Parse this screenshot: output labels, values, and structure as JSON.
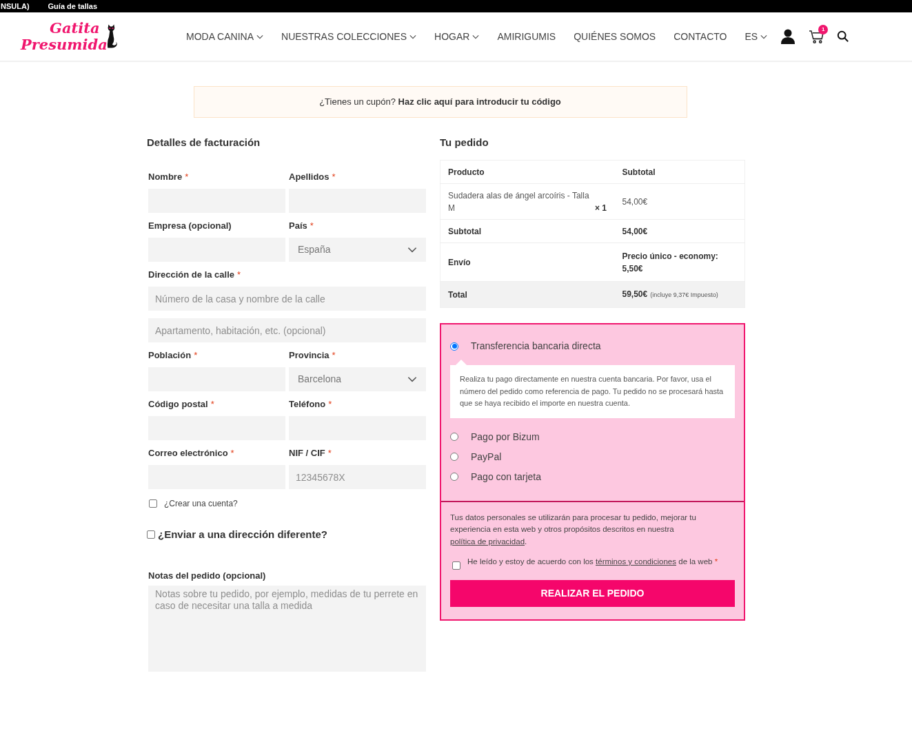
{
  "top_bar": {
    "items": [
      "NSULA)",
      "Guía de tallas"
    ]
  },
  "header": {
    "logo": {
      "line_1": "Gatita",
      "line_2": "Presumida"
    },
    "nav": [
      {
        "label": "MODA CANINA",
        "dropdown": true
      },
      {
        "label": "NUESTRAS COLECCIONES",
        "dropdown": true
      },
      {
        "label": "HOGAR",
        "dropdown": true
      },
      {
        "label": "AMIRIGUMIS",
        "dropdown": false
      },
      {
        "label": "QUIÉNES SOMOS",
        "dropdown": false
      },
      {
        "label": "CONTACTO",
        "dropdown": false
      },
      {
        "label": "ES",
        "dropdown": true
      }
    ],
    "cart_count": "1"
  },
  "coupon": {
    "text": "¿Tienes un cupón? **Haz clic aquí para introducir tu código**"
  },
  "billing": {
    "title": "Detalles de facturación",
    "rows": [
      [
        {
          "label": "Nombre",
          "required_mark": "*",
          "inputs": [
            {
              "kind": "input"
            }
          ]
        },
        {
          "label": "Apellidos",
          "required_mark": "*",
          "inputs": [
            {
              "kind": "input"
            }
          ]
        }
      ],
      [
        {
          "label": "Empresa (opcional)",
          "inputs": [
            {
              "kind": "input"
            }
          ]
        },
        {
          "label": "País",
          "required_mark": "*",
          "inputs": [
            {
              "kind": "select",
              "value": "España"
            }
          ]
        }
      ],
      [
        {
          "label": "Dirección de la calle",
          "required_mark": "*",
          "inputs": [
            {
              "kind": "input",
              "placeholder": "Número de la casa y nombre de la calle"
            },
            {
              "kind": "input",
              "placeholder": "Apartamento, habitación, etc. (opcional)"
            }
          ]
        }
      ],
      [
        {
          "label": "Población",
          "required_mark": "*",
          "inputs": [
            {
              "kind": "input"
            }
          ]
        },
        {
          "label": "Provincia",
          "required_mark": "*",
          "inputs": [
            {
              "kind": "select",
              "value": "Barcelona"
            }
          ]
        }
      ],
      [
        {
          "label": "Código postal",
          "required_mark": "*",
          "inputs": [
            {
              "kind": "input"
            }
          ]
        },
        {
          "label": "Teléfono",
          "required_mark": "*",
          "inputs": [
            {
              "kind": "input"
            }
          ]
        }
      ],
      [
        {
          "label": "Correo electrónico",
          "required_mark": "*",
          "inputs": [
            {
              "kind": "input"
            }
          ]
        },
        {
          "label": "NIF / CIF",
          "required_mark": "*",
          "inputs": [
            {
              "kind": "input",
              "placeholder": "12345678X"
            }
          ]
        }
      ]
    ],
    "create_account": {
      "label": "¿Crear una cuenta?",
      "checked": false
    },
    "ship_different": {
      "label": "¿Enviar a una dirección diferente?",
      "checked": false
    },
    "notes": {
      "label": "Notas del pedido (opcional)",
      "placeholder": "Notas sobre tu pedido, por ejemplo, medidas de tu perrete en caso de necesitar una talla a medida"
    }
  },
  "order": {
    "title": "Tu pedido",
    "columns": [
      "Producto",
      "Subtotal"
    ],
    "rows": [
      {
        "kind": "item",
        "label": "Sudadera alas de ángel arcoíris - Talla M",
        "quantity": "× 1",
        "value": "54,00€"
      },
      {
        "kind": "subtotal",
        "label": "Subtotal",
        "value": "54,00€"
      },
      {
        "kind": "shipping",
        "label": "Envío",
        "value": "Precio único - economy: 5,50€"
      },
      {
        "kind": "total",
        "label": "Total",
        "value": "59,50€",
        "note": "(incluye 9,37€ Impuesto)"
      }
    ]
  },
  "payment": {
    "methods": [
      {
        "label": "Transferencia bancaria directa",
        "selected": true,
        "description": "Realiza tu pago directamente en nuestra cuenta bancaria. Por favor, usa el número del pedido como referencia de pago. Tu pedido no se procesará hasta que se haya recibido el importe en nuestra cuenta."
      },
      {
        "label": "Pago por Bizum",
        "selected": false
      },
      {
        "label": "PayPal",
        "selected": false
      },
      {
        "label": "Pago con tarjeta",
        "selected": false
      }
    ],
    "privacy": {
      "text": "Tus datos personales se utilizarán para procesar tu pedido, mejorar tu experiencia en esta web y otros propósitos descritos en nuestra",
      "link": "política de privacidad",
      "after": "."
    },
    "terms": {
      "text": "He leído y estoy de acuerdo con los",
      "link": "términos y condiciones",
      "after": "de la web",
      "required_mark": "*",
      "checked": false
    },
    "button": "REALIZAR EL PEDIDO"
  }
}
